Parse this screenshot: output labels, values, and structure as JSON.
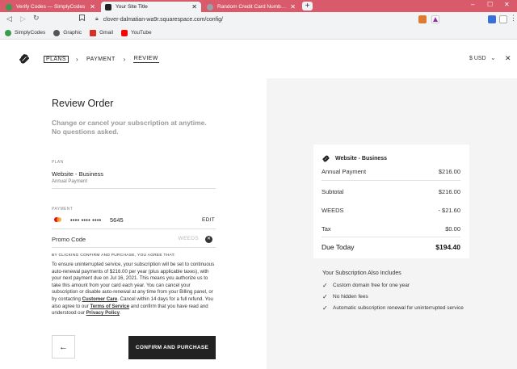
{
  "browser": {
    "tabs": [
      {
        "title": "Verify Codes — SimplyCodes",
        "favicon_color": "#3a9b4f",
        "active": false
      },
      {
        "title": "Your Site Title",
        "favicon_color": "#222222",
        "active": true
      },
      {
        "title": "Random Credit Card Numbers Gen",
        "favicon_color": "#9aa0a6",
        "active": false
      }
    ],
    "new_tab_label": "+",
    "url": "clover-dalmatian-wa9r.squarespace.com/config/",
    "bookmarks": [
      {
        "label": "SimplyCodes",
        "color": "#3a9b4f"
      },
      {
        "label": "Graphic",
        "color": "#555555"
      },
      {
        "label": "Gmail",
        "color": "#d93025"
      },
      {
        "label": "YouTube",
        "color": "#ff0000"
      }
    ],
    "tabstrip_color": "#d95a6a"
  },
  "header": {
    "crumbs": {
      "plans": "PLANS",
      "payment": "PAYMENT",
      "review": "REVIEW"
    },
    "currency": "$ USD"
  },
  "form": {
    "title": "Review Order",
    "subtitle": "Change or cancel your subscription at anytime. No questions asked.",
    "plan_label": "PLAN",
    "plan_name": "Website - Business",
    "plan_billing": "Annual Payment",
    "payment_label": "PAYMENT",
    "card_dots": "•••• •••• ••••",
    "card_last4": "5645",
    "edit_label": "EDIT",
    "promo_label": "Promo Code",
    "promo_value": "WEEDS",
    "agree_heading": "BY CLICKING CONFIRM AND PURCHASE, YOU AGREE THAT:",
    "legal": {
      "p1": "To ensure uninterrupted service, your subscription will be set to continuous auto-renewal payments of $216.00 per year (plus applicable taxes), with your next payment due on Jul 16, 2021. This means you authorize us to take this amount from your card each year. You can cancel your subscription or disable auto-renewal at any time from your Billing panel, or by contacting ",
      "link1": "Customer Care",
      "p2": ". Cancel within 14 days for a full refund. You also agree to our ",
      "link2": "Terms of Service",
      "p3": " and confirm that you have read and understood our ",
      "link3": "Privacy Policy",
      "p4": "."
    },
    "confirm_label": "CONFIRM AND PURCHASE"
  },
  "summary": {
    "title": "Website - Business",
    "rows": [
      {
        "label": "Annual Payment",
        "value": "$216.00"
      },
      {
        "label": "Subtotal",
        "value": "$216.00"
      },
      {
        "label": "WEEDS",
        "value": "- $21.60"
      },
      {
        "label": "Tax",
        "value": "$0.00"
      }
    ],
    "total_label": "Due Today",
    "total_value": "$194.40"
  },
  "includes": {
    "title": "Your Subscription Also Includes",
    "items": [
      "Custom domain free for one year",
      "No hidden fees",
      "Automatic subscription renewal for uninterrupted service"
    ]
  }
}
